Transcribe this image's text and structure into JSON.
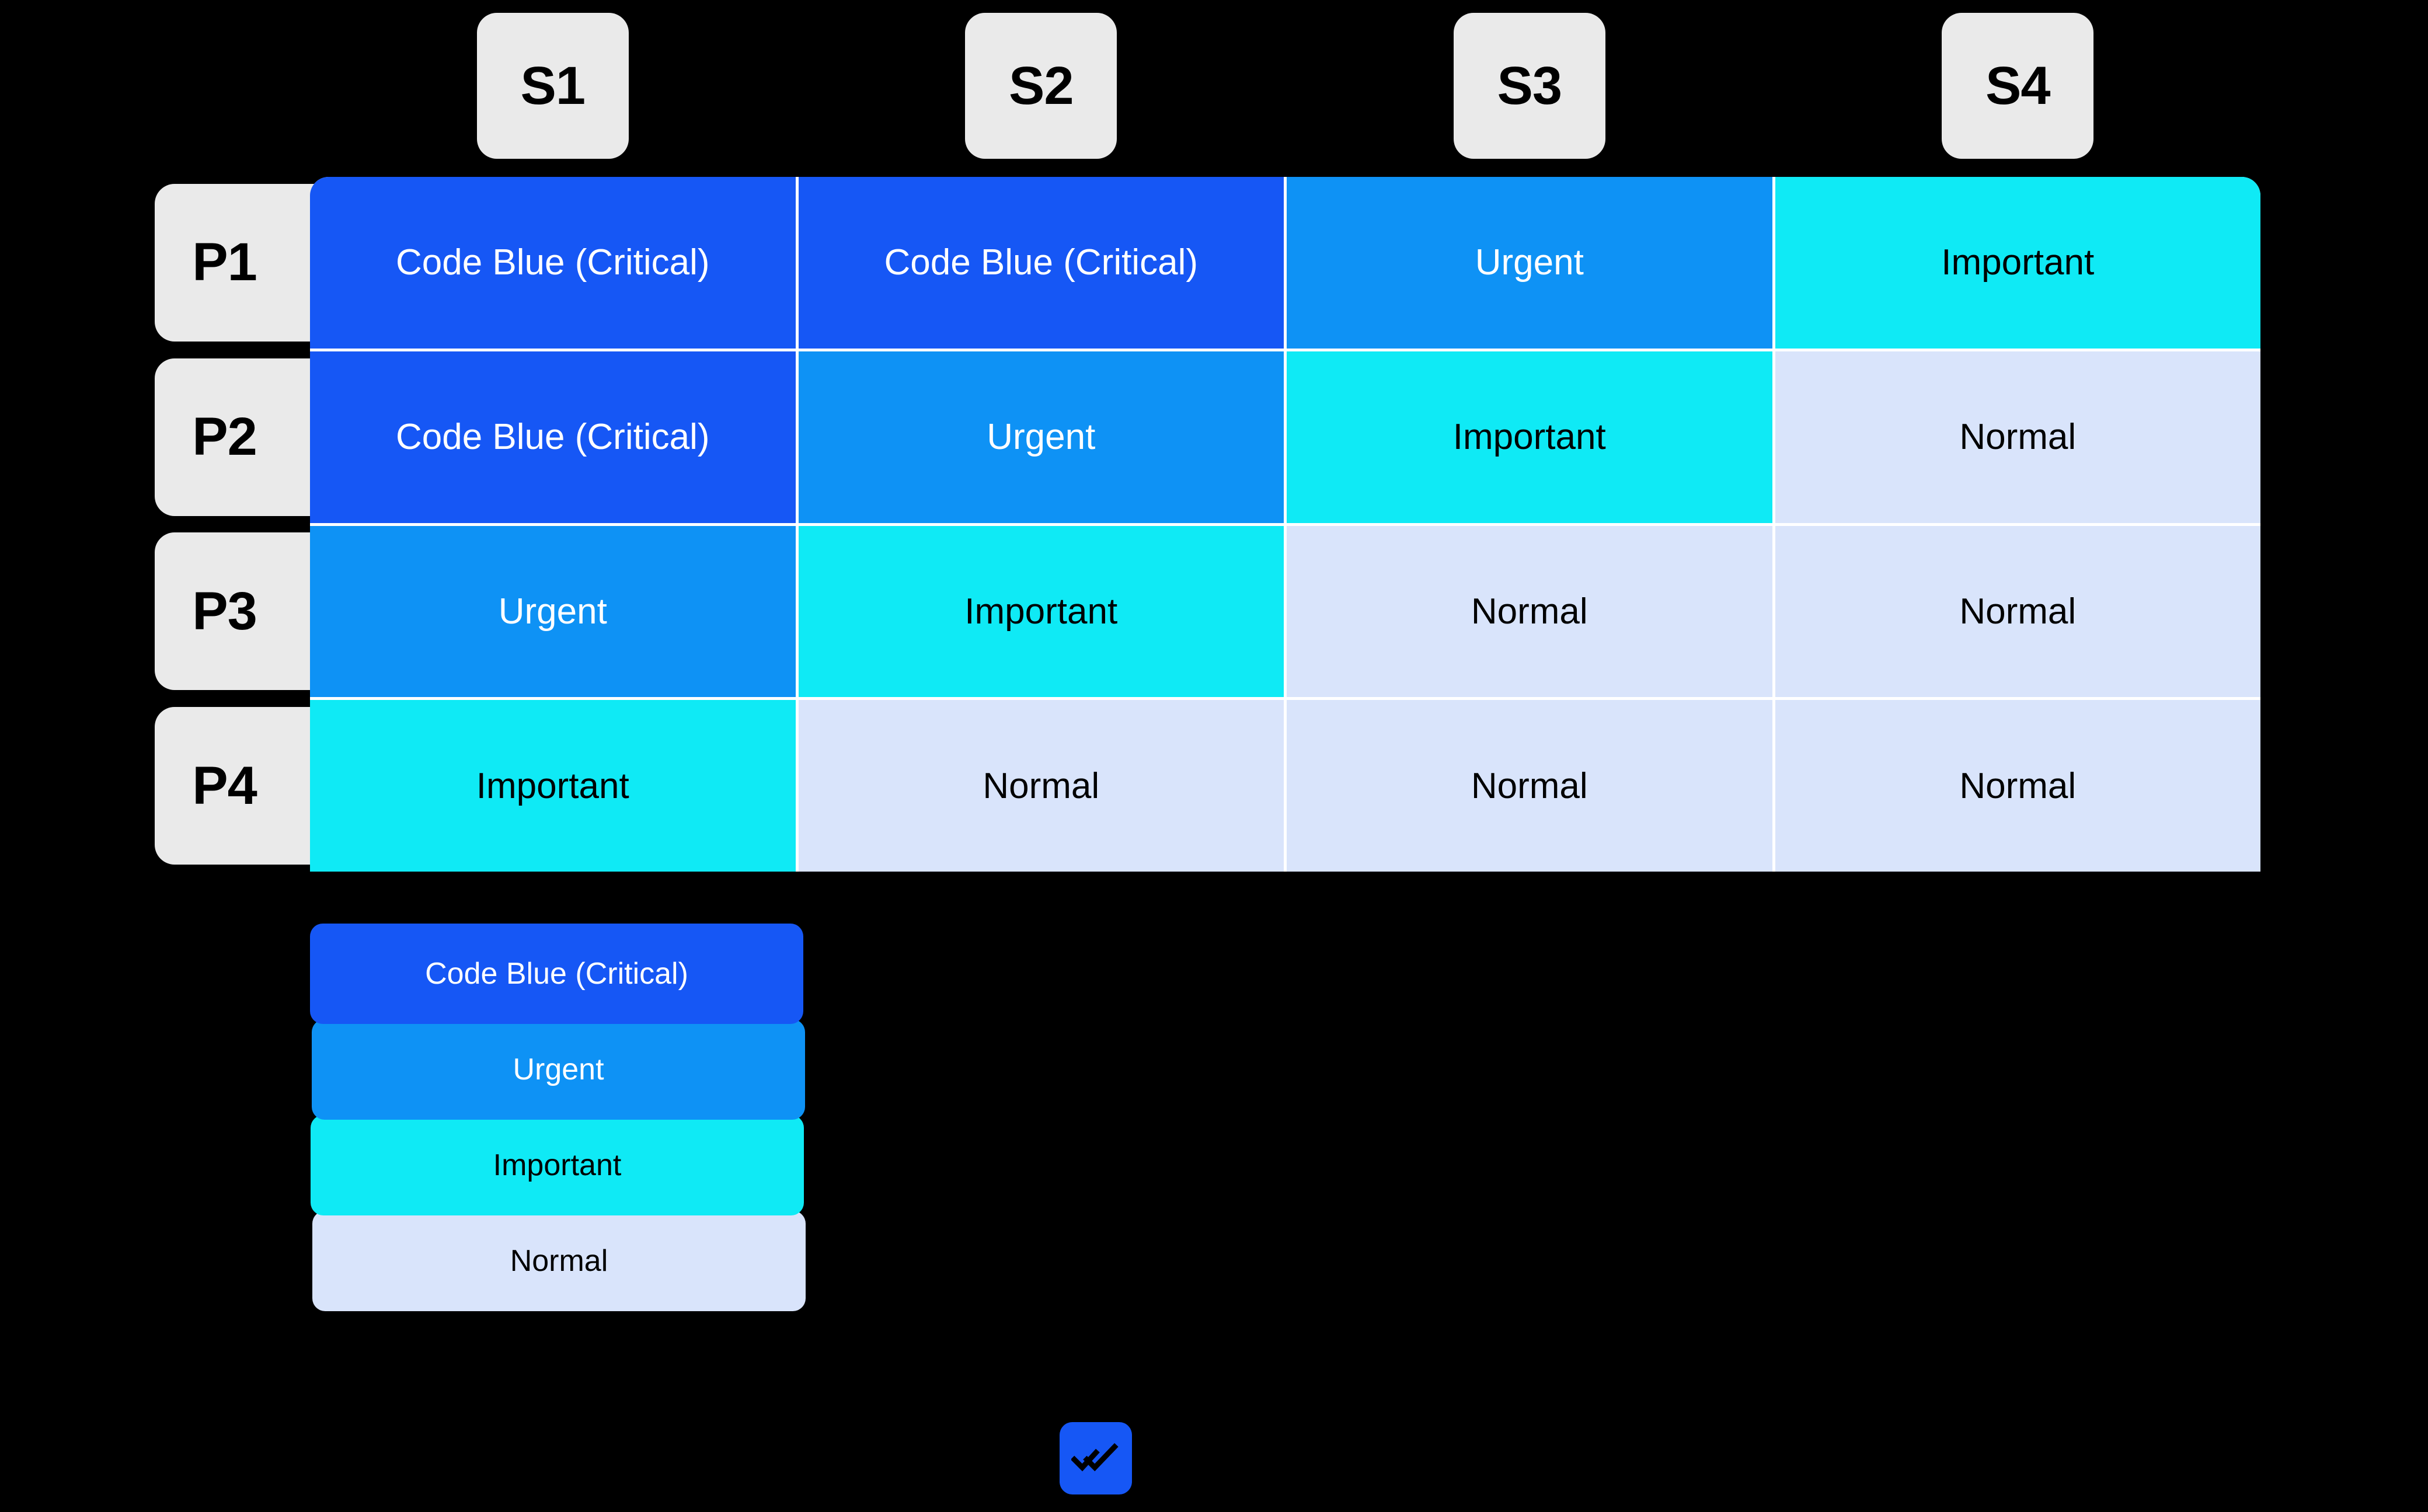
{
  "canvas": {
    "background": "#000000",
    "grid_line_color": "#FFFFFF"
  },
  "palette": {
    "code_blue": "#1657F5",
    "urgent": "#0E92F5",
    "important": "#0FEAF5",
    "normal": "#D9E4FB",
    "chip_gray": "#EAEAEA",
    "text_on_dark": "#FFFFFF",
    "text_on_light": "#000000"
  },
  "column_headers": [
    {
      "label": "S1"
    },
    {
      "label": "S2"
    },
    {
      "label": "S3"
    },
    {
      "label": "S4"
    }
  ],
  "row_headers": [
    {
      "label": "P1"
    },
    {
      "label": "P2"
    },
    {
      "label": "P3"
    },
    {
      "label": "P4"
    }
  ],
  "matrix": {
    "rows": [
      {
        "priority": "P1",
        "cells": [
          {
            "label": "Code Blue (Critical)",
            "bg": "#1657F5",
            "fg": "#FFFFFF"
          },
          {
            "label": "Code Blue (Critical)",
            "bg": "#1657F5",
            "fg": "#FFFFFF"
          },
          {
            "label": "Urgent",
            "bg": "#0E92F5",
            "fg": "#FFFFFF"
          },
          {
            "label": "Important",
            "bg": "#0FEAF5",
            "fg": "#000000"
          }
        ]
      },
      {
        "priority": "P2",
        "cells": [
          {
            "label": "Code Blue (Critical)",
            "bg": "#1657F5",
            "fg": "#FFFFFF"
          },
          {
            "label": "Urgent",
            "bg": "#0E92F5",
            "fg": "#FFFFFF"
          },
          {
            "label": "Important",
            "bg": "#0FEAF5",
            "fg": "#000000"
          },
          {
            "label": "Normal",
            "bg": "#D9E4FB",
            "fg": "#000000"
          }
        ]
      },
      {
        "priority": "P3",
        "cells": [
          {
            "label": "Urgent",
            "bg": "#0E92F5",
            "fg": "#FFFFFF"
          },
          {
            "label": "Important",
            "bg": "#0FEAF5",
            "fg": "#000000"
          },
          {
            "label": "Normal",
            "bg": "#D9E4FB",
            "fg": "#000000"
          },
          {
            "label": "Normal",
            "bg": "#D9E4FB",
            "fg": "#000000"
          }
        ]
      },
      {
        "priority": "P4",
        "cells": [
          {
            "label": "Important",
            "bg": "#0FEAF5",
            "fg": "#000000"
          },
          {
            "label": "Normal",
            "bg": "#D9E4FB",
            "fg": "#000000"
          },
          {
            "label": "Normal",
            "bg": "#D9E4FB",
            "fg": "#000000"
          },
          {
            "label": "Normal",
            "bg": "#D9E4FB",
            "fg": "#000000"
          }
        ]
      }
    ]
  },
  "legend": [
    {
      "label": "Code Blue (Critical)",
      "bg": "#1657F5",
      "fg": "#FFFFFF"
    },
    {
      "label": "Urgent",
      "bg": "#0E92F5",
      "fg": "#FFFFFF"
    },
    {
      "label": "Important",
      "bg": "#0FEAF5",
      "fg": "#000000"
    },
    {
      "label": "Normal",
      "bg": "#D9E4FB",
      "fg": "#000000"
    }
  ],
  "footer": {
    "logo": {
      "icon": "double-check-icon",
      "bg": "#1657F5",
      "glyph_color": "#000000"
    }
  }
}
